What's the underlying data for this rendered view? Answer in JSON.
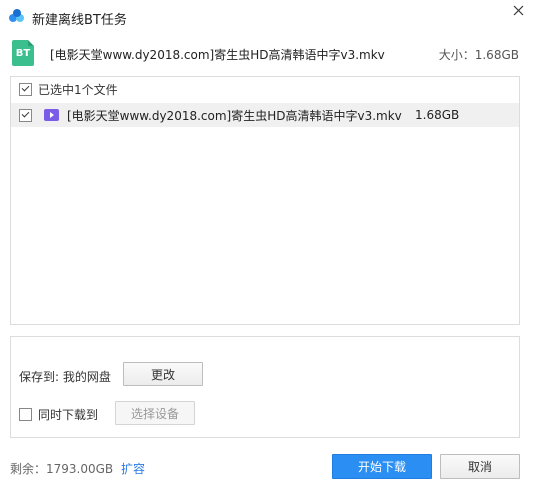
{
  "window": {
    "title": "新建离线BT任务",
    "logo_icon": "cloud-logo-icon",
    "close_icon": "close-icon"
  },
  "file_header": {
    "icon_text": "BT",
    "file_name": "[电影天堂www.dy2018.com]寄生虫HD高清韩语中字v3.mkv",
    "size_label": "大小：1.68GB"
  },
  "file_list": {
    "select_all_label": "已选中1个文件",
    "select_all_checked": true,
    "items": [
      {
        "checked": true,
        "icon": "video-file-icon",
        "name": "[电影天堂www.dy2018.com]寄生虫HD高清韩语中字v3.mkv",
        "size": "1.68GB"
      }
    ]
  },
  "save": {
    "label": "保存到: 我的网盘",
    "change_button": "更改",
    "sync_label": "同时下载到",
    "sync_checked": false,
    "choose_device_button": "选择设备"
  },
  "footer": {
    "remaining": "剩余：1793.00GB",
    "expand_link": "扩容",
    "start_button": "开始下载",
    "cancel_button": "取消"
  },
  "colors": {
    "accent": "#2b8ef2",
    "bt_icon": "#3cbf8f",
    "video_icon": "#7b5ce6",
    "link": "#2a7be4"
  }
}
